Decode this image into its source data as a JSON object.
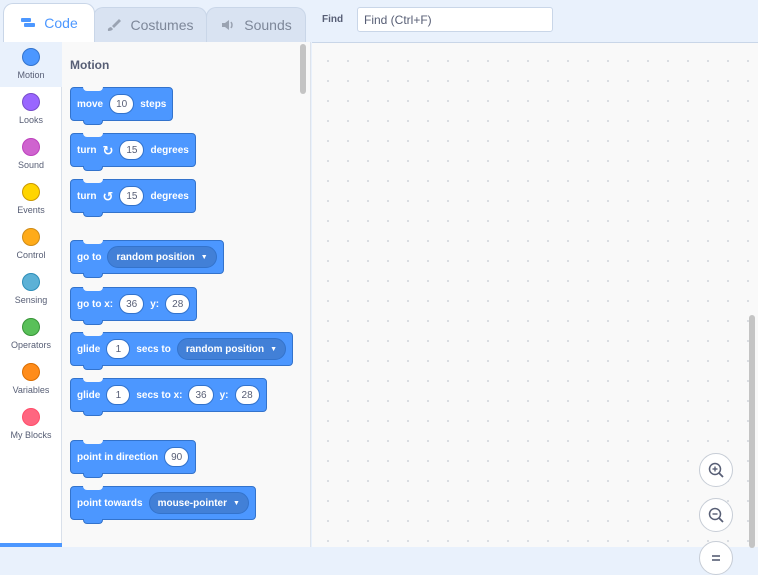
{
  "tabs": [
    {
      "label": "Code",
      "icon": "code-icon"
    },
    {
      "label": "Costumes",
      "icon": "brush-icon"
    },
    {
      "label": "Sounds",
      "icon": "speaker-icon"
    }
  ],
  "find": {
    "label": "Find",
    "placeholder": "Find (Ctrl+F)"
  },
  "categories": [
    {
      "label": "Motion",
      "color": "#4c97ff"
    },
    {
      "label": "Looks",
      "color": "#9966ff"
    },
    {
      "label": "Sound",
      "color": "#cf63cf"
    },
    {
      "label": "Events",
      "color": "#ffd500"
    },
    {
      "label": "Control",
      "color": "#ffab19"
    },
    {
      "label": "Sensing",
      "color": "#5cb1d6"
    },
    {
      "label": "Operators",
      "color": "#59c059"
    },
    {
      "label": "Variables",
      "color": "#ff8c1a"
    },
    {
      "label": "My Blocks",
      "color": "#ff6680"
    }
  ],
  "flyout": {
    "title": "Motion",
    "blocks": {
      "move": {
        "pre": "move",
        "value": "10",
        "post": "steps"
      },
      "turn_right": {
        "pre": "turn",
        "value": "15",
        "post": "degrees"
      },
      "turn_left": {
        "pre": "turn",
        "value": "15",
        "post": "degrees"
      },
      "go_to": {
        "pre": "go to",
        "menu": "random position"
      },
      "go_to_xy": {
        "pre": "go to x:",
        "x": "36",
        "mid": "y:",
        "y": "28"
      },
      "glide_to": {
        "pre": "glide",
        "value": "1",
        "mid": "secs to",
        "menu": "random position"
      },
      "glide_xy": {
        "pre": "glide",
        "value": "1",
        "mid": "secs to x:",
        "x": "36",
        "mid2": "y:",
        "y": "28"
      },
      "point_dir": {
        "pre": "point in direction",
        "value": "90"
      },
      "point_towards": {
        "pre": "point towards",
        "menu": "mouse-pointer"
      }
    }
  },
  "colors": {
    "motion": "#4c97ff",
    "accent": "#4c97ff",
    "text": "#575e75"
  }
}
